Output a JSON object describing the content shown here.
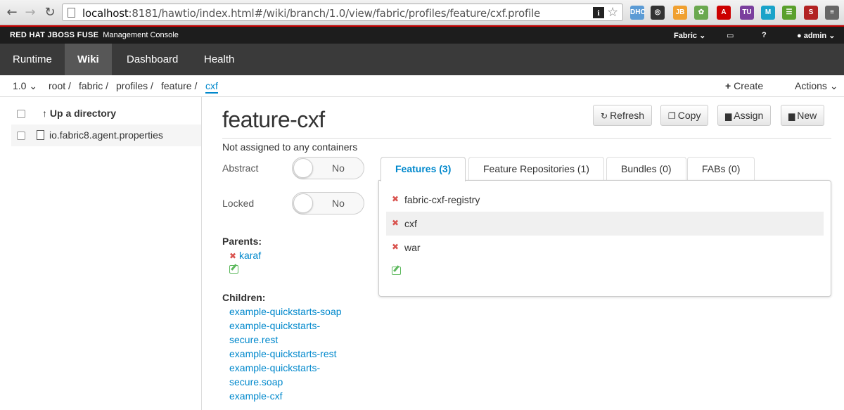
{
  "browser": {
    "back_icon": "back-arrow-icon",
    "forward_icon": "forward-arrow-icon",
    "reload_icon": "reload-icon",
    "url_host": "localhost",
    "url_rest": ":8181/hawtio/index.html#/wiki/branch/1.0/view/fabric/profiles/feature/cxf.profile",
    "extensions": [
      {
        "name": "ext-bluesky-icon",
        "color": "#5b9bd5",
        "label": "DHC"
      },
      {
        "name": "ext-circle-icon",
        "color": "#333333",
        "label": "◎"
      },
      {
        "name": "ext-jb-icon",
        "color": "#f0a030",
        "label": "JB"
      },
      {
        "name": "ext-tree-icon",
        "color": "#6aa84f",
        "label": "✿"
      },
      {
        "name": "ext-acrobat-icon",
        "color": "#cc0000",
        "label": "A"
      },
      {
        "name": "ext-tu-icon",
        "color": "#7a3e9d",
        "label": "TU"
      },
      {
        "name": "ext-m-icon",
        "color": "#1aa3c9",
        "label": "M"
      },
      {
        "name": "ext-green-icon",
        "color": "#5aa02c",
        "label": "☰"
      },
      {
        "name": "ext-s-icon",
        "color": "#b22222",
        "label": "S"
      },
      {
        "name": "ext-menu-icon",
        "color": "#666666",
        "label": "≡"
      }
    ]
  },
  "brand": {
    "title": "RED HAT JBOSS FUSE",
    "subtitle": "Management Console",
    "fabric_menu": "Fabric",
    "user_menu": "admin"
  },
  "nav": {
    "tabs": [
      {
        "label": "Runtime",
        "active": false
      },
      {
        "label": "Wiki",
        "active": true
      },
      {
        "label": "Dashboard",
        "active": false
      },
      {
        "label": "Health",
        "active": false
      }
    ]
  },
  "breadcrumb": {
    "branch": "1.0",
    "items": [
      "root /",
      "fabric /",
      "profiles /",
      "feature /"
    ],
    "current": "cxf",
    "create": "Create",
    "actions": "Actions"
  },
  "files": {
    "up": "Up a directory",
    "items": [
      "io.fabric8.agent.properties"
    ]
  },
  "profile": {
    "title": "feature-cxf",
    "status": "Not assigned to any containers",
    "abstract_label": "Abstract",
    "abstract_value": "No",
    "locked_label": "Locked",
    "locked_value": "No",
    "parents_label": "Parents:",
    "parents": [
      "karaf"
    ],
    "children_label": "Children:",
    "children": [
      "example-quickstarts-soap",
      "example-quickstarts-",
      "secure.rest",
      "example-quickstarts-rest",
      "example-quickstarts-",
      "secure.soap",
      "example-cxf"
    ]
  },
  "buttons": {
    "refresh": "Refresh",
    "copy": "Copy",
    "assign": "Assign",
    "new": "New"
  },
  "tabs": [
    {
      "label": "Features (3)",
      "active": true
    },
    {
      "label": "Feature Repositories (1)",
      "active": false
    },
    {
      "label": "Bundles (0)",
      "active": false
    },
    {
      "label": "FABs (0)",
      "active": false
    }
  ],
  "features": [
    "fabric-cxf-registry",
    "cxf",
    "war"
  ]
}
